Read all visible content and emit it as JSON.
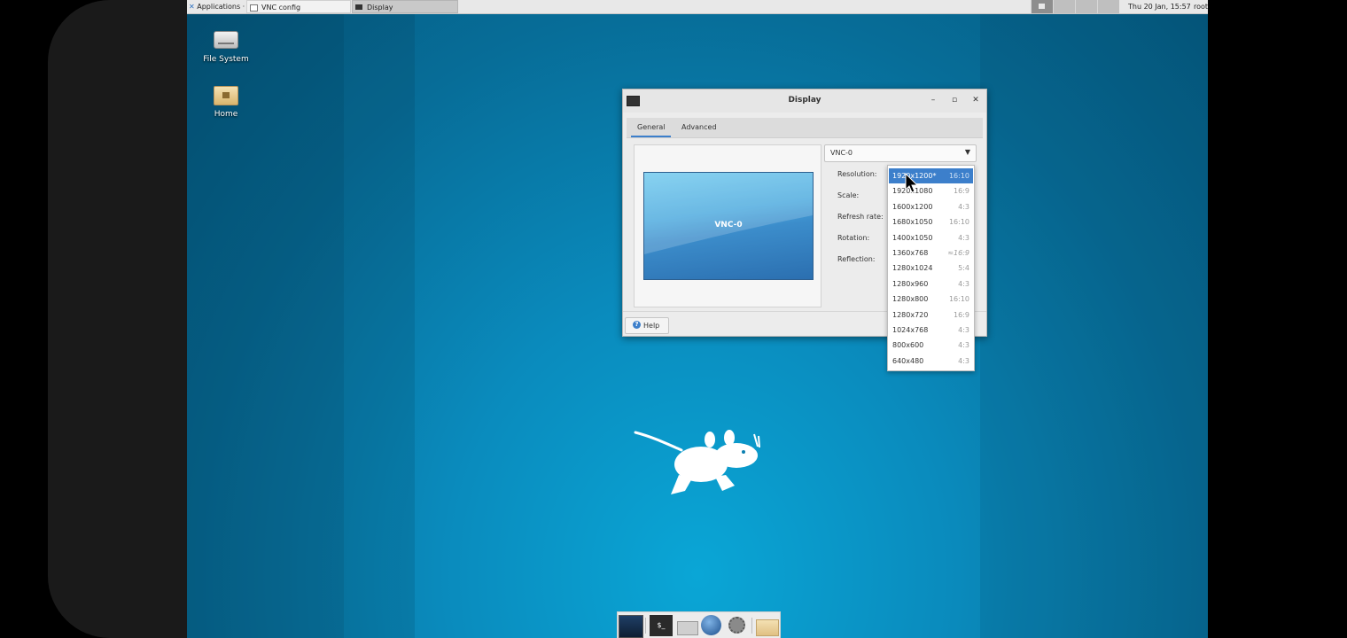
{
  "panel": {
    "applications_label": "Applications ·",
    "tasks": [
      {
        "label": "VNC config",
        "active": false
      },
      {
        "label": "Display",
        "active": true
      }
    ],
    "clock": "Thu 20 Jan, 15:57",
    "user": "root"
  },
  "desktop": {
    "icons": [
      {
        "label": "File System",
        "icon": "drive-icon"
      },
      {
        "label": "Home",
        "icon": "home-folder-icon"
      }
    ]
  },
  "window": {
    "title": "Display",
    "tabs": [
      "General",
      "Advanced"
    ],
    "active_tab": "General",
    "monitor_label": "VNC-0",
    "output_select_value": "VNC-0",
    "labels": {
      "resolution": "Resolution:",
      "scale": "Scale:",
      "refresh_rate": "Refresh rate:",
      "rotation": "Rotation:",
      "reflection": "Reflection:"
    },
    "help_label": "Help"
  },
  "resolution_dropdown": {
    "selected": "1920x1200*",
    "items": [
      {
        "res": "1920x1200*",
        "ratio": "16:10"
      },
      {
        "res": "1920x1080",
        "ratio": "16:9"
      },
      {
        "res": "1600x1200",
        "ratio": "4:3"
      },
      {
        "res": "1680x1050",
        "ratio": "16:10"
      },
      {
        "res": "1400x1050",
        "ratio": "4:3"
      },
      {
        "res": "1360x768",
        "ratio": "≈16:9"
      },
      {
        "res": "1280x1024",
        "ratio": "5:4"
      },
      {
        "res": "1280x960",
        "ratio": "4:3"
      },
      {
        "res": "1280x800",
        "ratio": "16:10"
      },
      {
        "res": "1280x720",
        "ratio": "16:9"
      },
      {
        "res": "1024x768",
        "ratio": "4:3"
      },
      {
        "res": "800x600",
        "ratio": "4:3"
      },
      {
        "res": "640x480",
        "ratio": "4:3"
      }
    ]
  },
  "dock": {
    "items": [
      "show-desktop-icon",
      "terminal-icon",
      "home-folder-icon",
      "web-browser-icon",
      "settings-icon",
      "folder-icon"
    ]
  },
  "colors": {
    "desktop_bg": "#0a8bbd",
    "selection": "#3c7fcb",
    "panel_bg": "#e8e8e8"
  }
}
